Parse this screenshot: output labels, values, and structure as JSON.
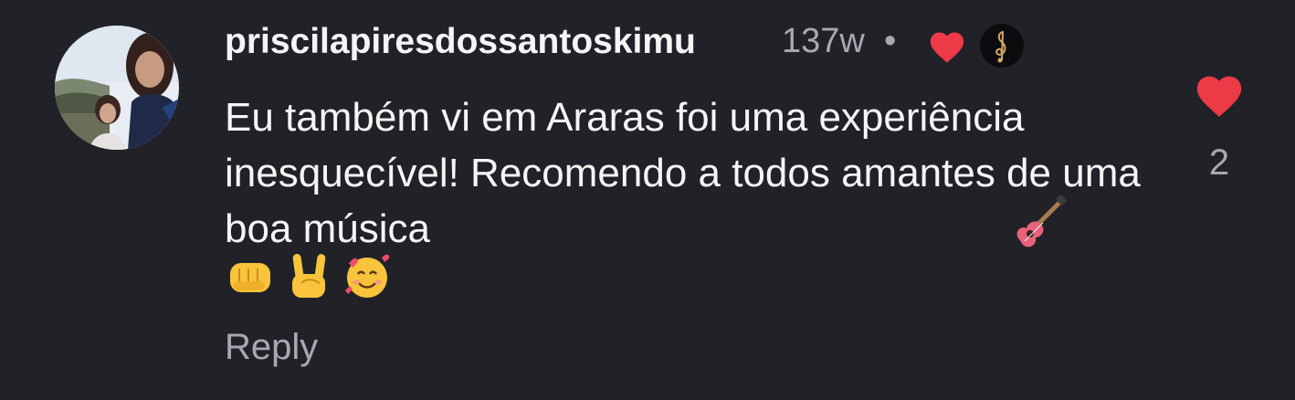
{
  "comment": {
    "username": "priscilapiresdossantoskimu",
    "timestamp": "137w",
    "separator": "•",
    "text": "Eu também vi em Araras foi uma experiência inesquecível! Recomendo a todos amantes de uma boa música",
    "emoji_inline": "guitar-emoji",
    "emoji_row": [
      "oncoming-fist-emoji",
      "sign-of-the-horns-emoji",
      "smiling-face-with-hearts-emoji"
    ],
    "reply_label": "Reply",
    "like_count": "2"
  },
  "colors": {
    "background": "#212128",
    "text": "#f5f5f5",
    "muted": "#a7a9b0",
    "heart": "#ed3a47"
  },
  "icons": {
    "creator_liked": "heart-icon",
    "creator_avatar": "music-clef-icon",
    "like": "heart-icon"
  }
}
